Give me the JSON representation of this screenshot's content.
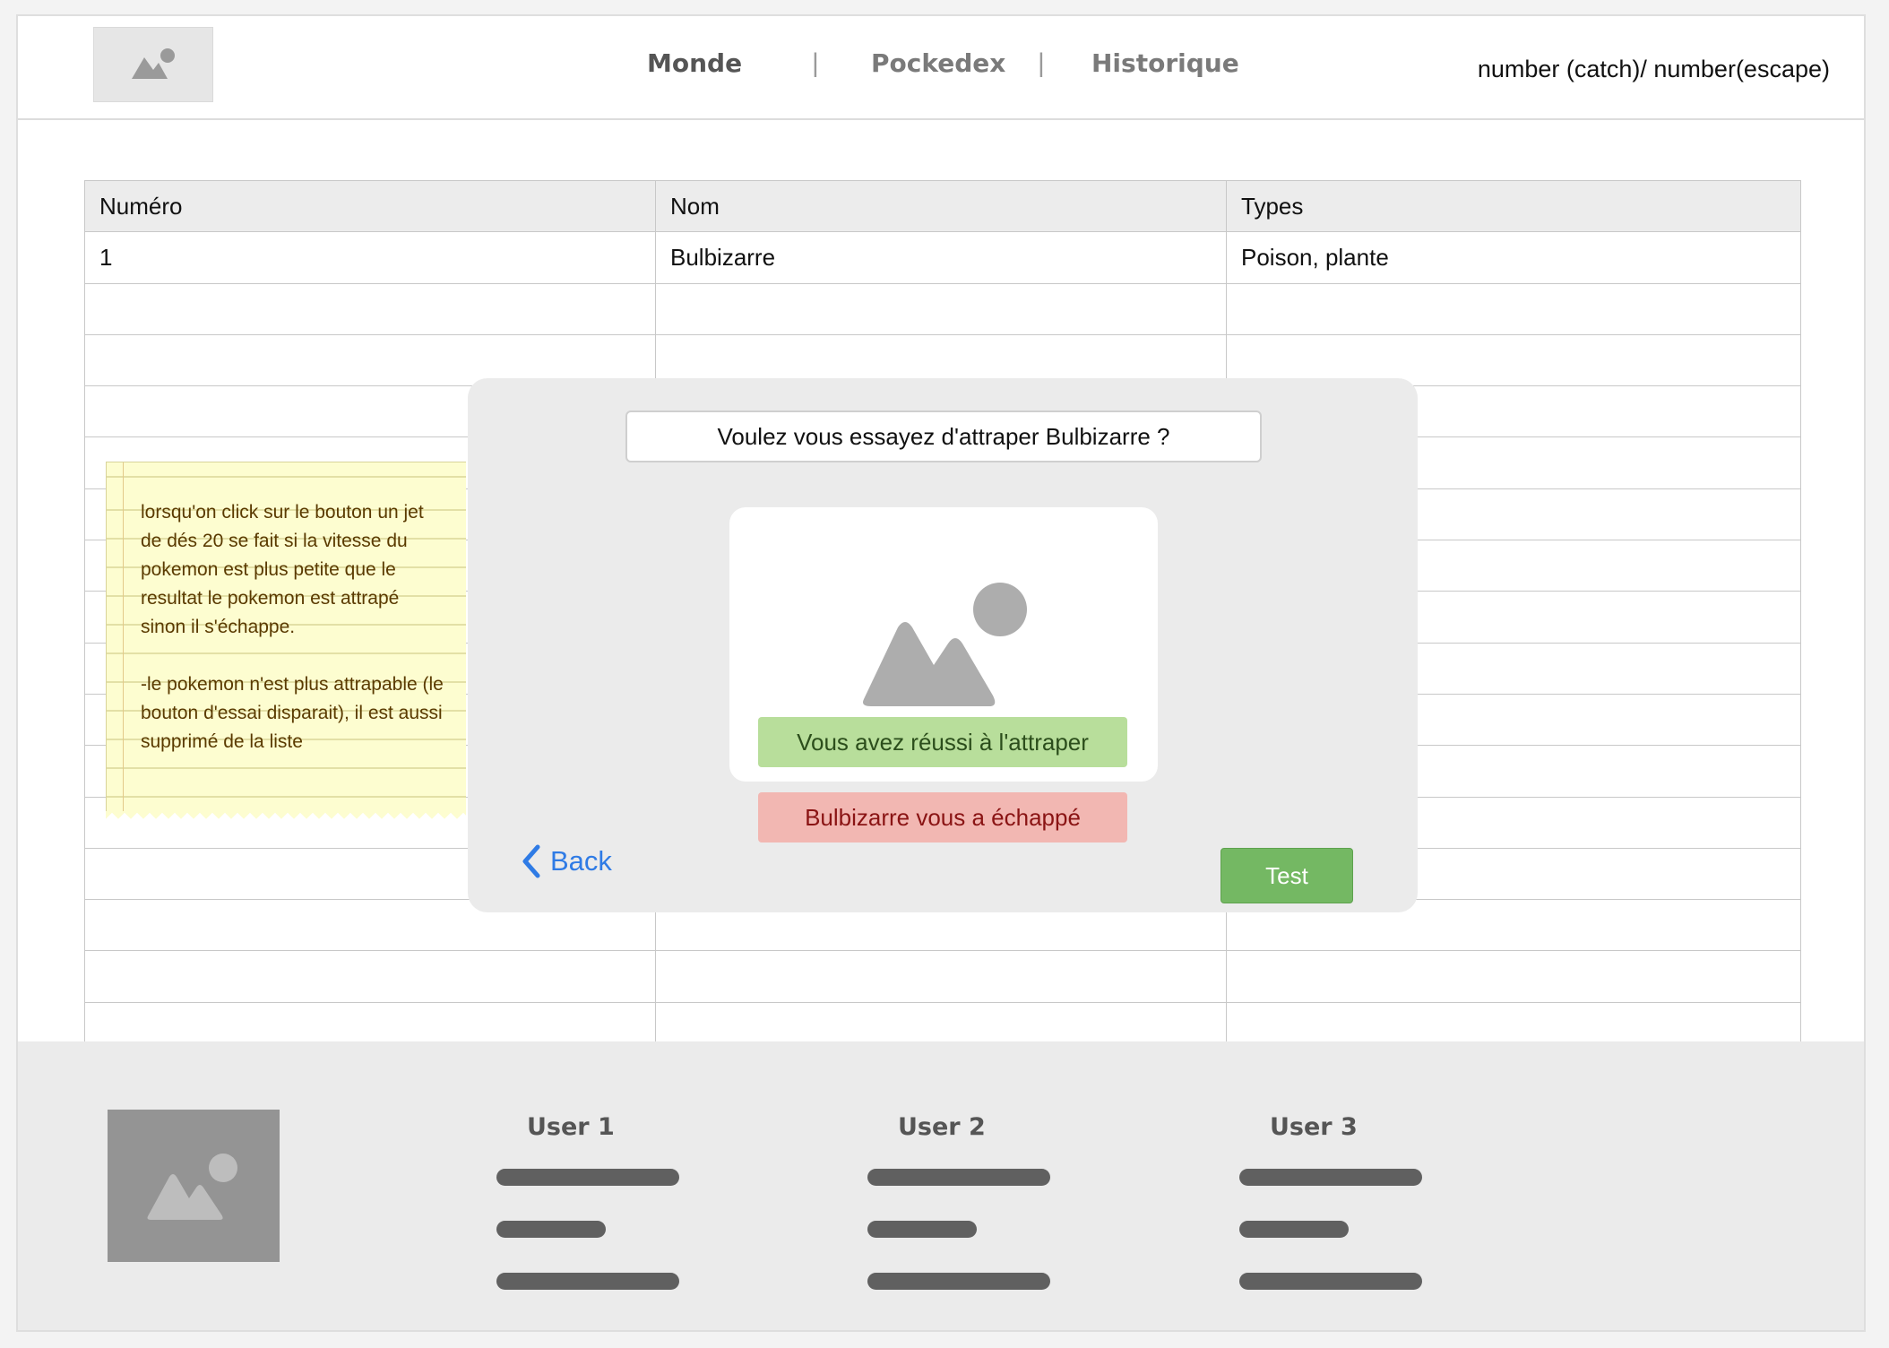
{
  "header": {
    "nav": [
      {
        "label": "Monde",
        "active": true
      },
      {
        "label": "Pockedex",
        "active": false
      },
      {
        "label": "Historique",
        "active": false
      }
    ],
    "separator": "|",
    "counter": "number (catch)/ number(escape)"
  },
  "table": {
    "columns": [
      "Numéro",
      "Nom",
      "Types"
    ],
    "rows": [
      [
        "1",
        "Bulbizarre",
        "Poison, plante"
      ]
    ]
  },
  "note": {
    "paragraphs": [
      "lorsqu'on click sur le bouton un jet de dés 20 se fait si la vitesse du pokemon est plus petite que le resultat le pokemon est attrapé sinon il s'échappe.",
      "-le pokemon n'est plus attrapable (le bouton d'essai disparait), il est aussi supprimé de la liste"
    ]
  },
  "modal": {
    "question": "Voulez vous essayez d'attraper Bulbizarre ?",
    "success": "Vous avez réussi à l'attraper",
    "failure": "Bulbizarre vous a échappé",
    "back_label": "Back",
    "test_label": "Test"
  },
  "footer": {
    "users": [
      "User 1",
      "User 2",
      "User 3"
    ]
  },
  "colors": {
    "accent_link": "#2f7be5",
    "success_bg": "#b8de9b",
    "failure_bg": "#f2b7b2",
    "test_button": "#74b863"
  },
  "icons": {
    "logo": "image-placeholder-icon",
    "back": "chevron-left-icon"
  }
}
